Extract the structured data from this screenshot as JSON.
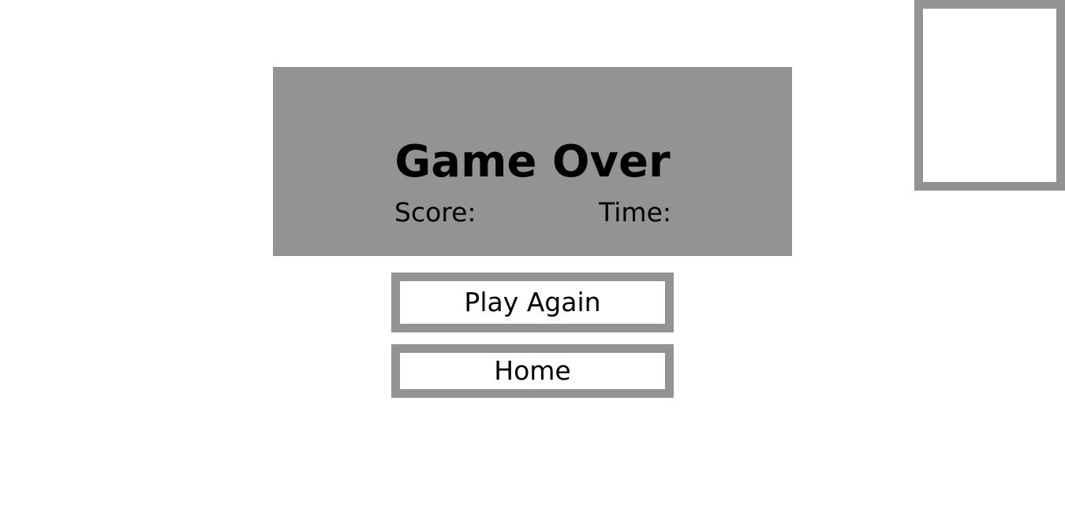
{
  "game_over": {
    "title": "Game Over",
    "score_label": "Score:",
    "time_label": "Time:"
  },
  "buttons": {
    "play_again": "Play Again",
    "home": "Home"
  },
  "colors": {
    "panel": "#939393",
    "border": "#939393",
    "background": "#ffffff",
    "text": "#000000"
  }
}
